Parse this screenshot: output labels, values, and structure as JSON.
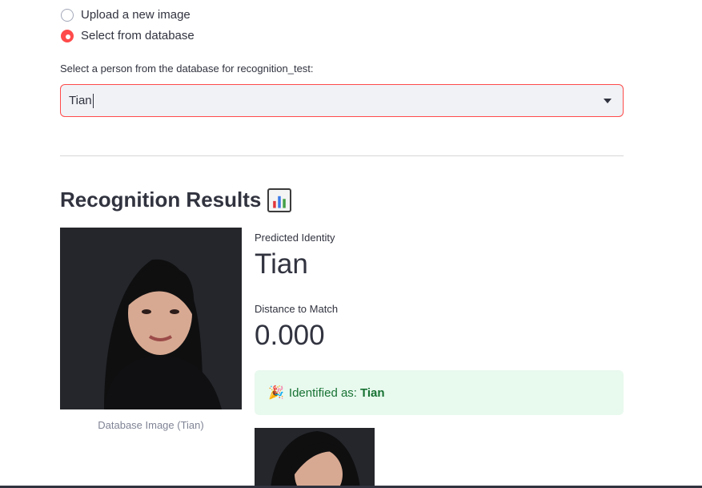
{
  "source_options": [
    {
      "label": "Upload a new image",
      "selected": false
    },
    {
      "label": "Select from database",
      "selected": true
    }
  ],
  "select": {
    "label": "Select a person from the database for recognition_test:",
    "value": "Tian"
  },
  "results": {
    "title": "Recognition Results",
    "title_icon": "bar-chart-icon",
    "database_image_caption": "Database Image (Tian)",
    "predicted_identity_label": "Predicted Identity",
    "predicted_identity_value": "Tian",
    "distance_label": "Distance to Match",
    "distance_value": "0.000",
    "success_prefix": "Identified as:",
    "success_name": "Tian",
    "success_icon": "party-popper-icon"
  },
  "colors": {
    "accent": "#ff4b4b",
    "success_bg": "#e8f9ee",
    "success_text": "#177233"
  }
}
